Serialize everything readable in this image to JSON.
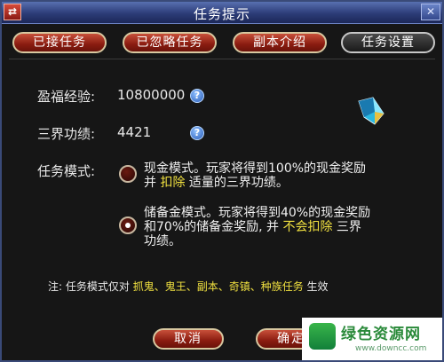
{
  "window": {
    "title": "任务提示",
    "icon": "window-menu-icon",
    "close_icon": "close-icon"
  },
  "tabs": [
    {
      "label": "已接任务",
      "active": false
    },
    {
      "label": "已忽略任务",
      "active": false
    },
    {
      "label": "副本介绍",
      "active": false
    },
    {
      "label": "任务设置",
      "active": true
    }
  ],
  "stats": {
    "exp_label": "盈福经验:",
    "exp_value": "10800000",
    "merit_label": "三界功绩:",
    "merit_value": "4421",
    "help_glyph": "?"
  },
  "mode": {
    "label": "任务模式:",
    "options": [
      {
        "checked": false,
        "line1": "现金模式。玩家将得到100%的现金奖励",
        "line2_pre": "并 ",
        "line2_hl": "扣除",
        "line2_post": " 适量的三界功绩。"
      },
      {
        "checked": true,
        "line1": "储备金模式。玩家将得到40%的现金奖励",
        "line2_pre": "和70%的储备金奖励, 并 ",
        "line2_hl": "不会扣除",
        "line2_post": " 三界",
        "line3": "功绩。"
      }
    ]
  },
  "note": {
    "prefix": "注: 任务模式仅对 ",
    "items": "抓鬼、鬼王、副本、奇镇、种族任务",
    "suffix": " 生效"
  },
  "buttons": {
    "cancel": "取消",
    "confirm": "确定"
  },
  "watermark": {
    "text": "绿色资源网",
    "url": "www.downcc.com"
  },
  "colors": {
    "highlight": "#f0e040",
    "button_red": "#8a1c10",
    "title_blue": "#2c3c78"
  }
}
